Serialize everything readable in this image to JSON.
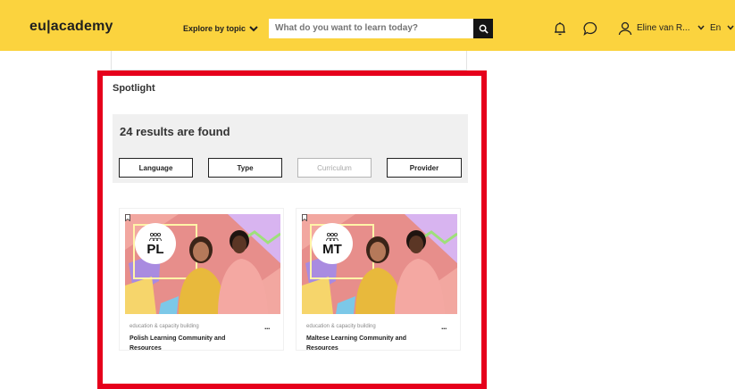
{
  "header": {
    "logo": "eu|academy",
    "explore_label": "Explore by topic",
    "search_placeholder": "What do you want to learn today?",
    "user_name": "Eline van R...",
    "language": "En"
  },
  "spotlight": {
    "title": "Spotlight",
    "results_text": "24 results are found",
    "filters": [
      {
        "label": "Language",
        "enabled": true
      },
      {
        "label": "Type",
        "enabled": true
      },
      {
        "label": "Curriculum",
        "enabled": false
      },
      {
        "label": "Provider",
        "enabled": true
      }
    ]
  },
  "cards": [
    {
      "code": "PL",
      "category": "education & capacity building",
      "title": "Polish Learning Community and Resources",
      "more": "..."
    },
    {
      "code": "MT",
      "category": "education & capacity building",
      "title": "Maltese Learning Community and Resources",
      "more": "..."
    }
  ],
  "colors": {
    "header_bg": "#fbd33e",
    "highlight_border": "#e6001c",
    "panel_bg": "#f0f0f0"
  },
  "icons": [
    "chevron-down-icon",
    "search-icon",
    "bell-icon",
    "chat-icon",
    "user-icon",
    "bookmark-icon",
    "community-icon"
  ]
}
